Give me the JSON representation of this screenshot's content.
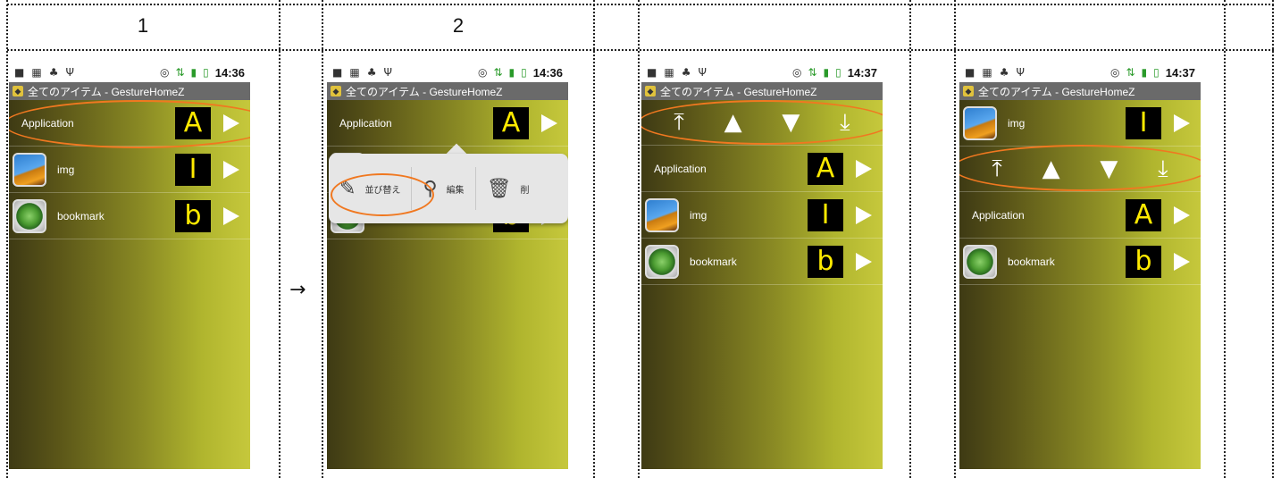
{
  "step_headers": [
    "1",
    "2",
    "",
    ""
  ],
  "flow_arrow": "→",
  "status": {
    "time_1": "14:36",
    "time_2": "14:36",
    "time_3": "14:37",
    "time_4": "14:37",
    "left_icons": [
      "briefcase-icon",
      "calendar-icon",
      "android-icon",
      "usb-icon"
    ],
    "right_icons": [
      "alarm-icon",
      "data-icon",
      "signal-icon",
      "battery-icon"
    ]
  },
  "title": "全てのアイテム - GestureHomeZ",
  "items": {
    "application": {
      "label": "Application",
      "gesture": "A"
    },
    "img": {
      "label": "img",
      "gesture": "I"
    },
    "bookmark": {
      "label": "bookmark",
      "gesture": "b"
    }
  },
  "popup": {
    "sort": "並び替え",
    "edit": "編集",
    "delete": "削"
  },
  "controls": {
    "top": "⤒",
    "up": "▲",
    "down": "▼",
    "bottom": "⤓"
  },
  "colors": {
    "highlight": "#f07820",
    "gesture_ink": "#ffea00",
    "panel_dark": "#3e3a14",
    "panel_light": "#c6c83c"
  }
}
